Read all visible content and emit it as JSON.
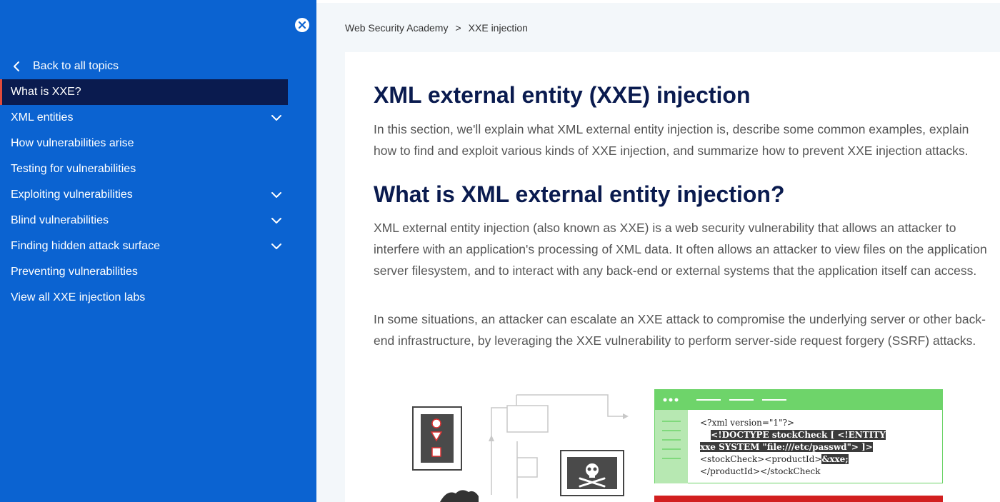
{
  "sidebar": {
    "close_icon": "close-icon",
    "back_label": "Back to all topics",
    "items": [
      {
        "label": "What is XXE?",
        "expandable": false,
        "active": true
      },
      {
        "label": "XML entities",
        "expandable": true,
        "active": false
      },
      {
        "label": "How vulnerabilities arise",
        "expandable": false,
        "active": false
      },
      {
        "label": "Testing for vulnerabilities",
        "expandable": false,
        "active": false
      },
      {
        "label": "Exploiting vulnerabilities",
        "expandable": true,
        "active": false
      },
      {
        "label": "Blind vulnerabilities",
        "expandable": true,
        "active": false
      },
      {
        "label": "Finding hidden attack surface",
        "expandable": true,
        "active": false
      },
      {
        "label": "Preventing vulnerabilities",
        "expandable": false,
        "active": false
      },
      {
        "label": "View all XXE injection labs",
        "expandable": false,
        "active": false
      }
    ]
  },
  "breadcrumb": {
    "root": "Web Security Academy",
    "separator": ">",
    "current": "XXE injection"
  },
  "article": {
    "title": "XML external entity (XXE) injection",
    "intro": "In this section, we'll explain what XML external entity injection is, describe some common examples, explain how to find and exploit various kinds of XXE injection, and summarize how to prevent XXE injection attacks.",
    "section_title": "What is XML external entity injection?",
    "para1": "XML external entity injection (also known as XXE) is a web security vulnerability that allows an attacker to interfere with an application's processing of XML data. It often allows an attacker to view files on the application server filesystem, and to interact with any back-end or external systems that the application itself can access.",
    "para2": "In some situations, an attacker can escalate an XXE attack to compromise the underlying server or other back-end infrastructure, by leveraging the XXE vulnerability to perform server-side request forgery (SSRF) attacks."
  },
  "illustration": {
    "code_line1": "<?xml version=\"1\"?>",
    "code_line2": "<!DOCTYPE stockCheck [ <!ENTITY",
    "code_line3": "xxe SYSTEM \"file:///etc/passwd\"> ]>",
    "code_line4a": "<stockCheck><productId>",
    "code_line4b": "&xxe;",
    "code_line5": "</productId></stockCheck"
  },
  "colors": {
    "sidebar_bg": "#0b63d1",
    "active_bg": "#0a1b4f",
    "active_accent": "#e24b3b",
    "heading": "#0a1b4f",
    "code_green": "#6ed46a"
  }
}
